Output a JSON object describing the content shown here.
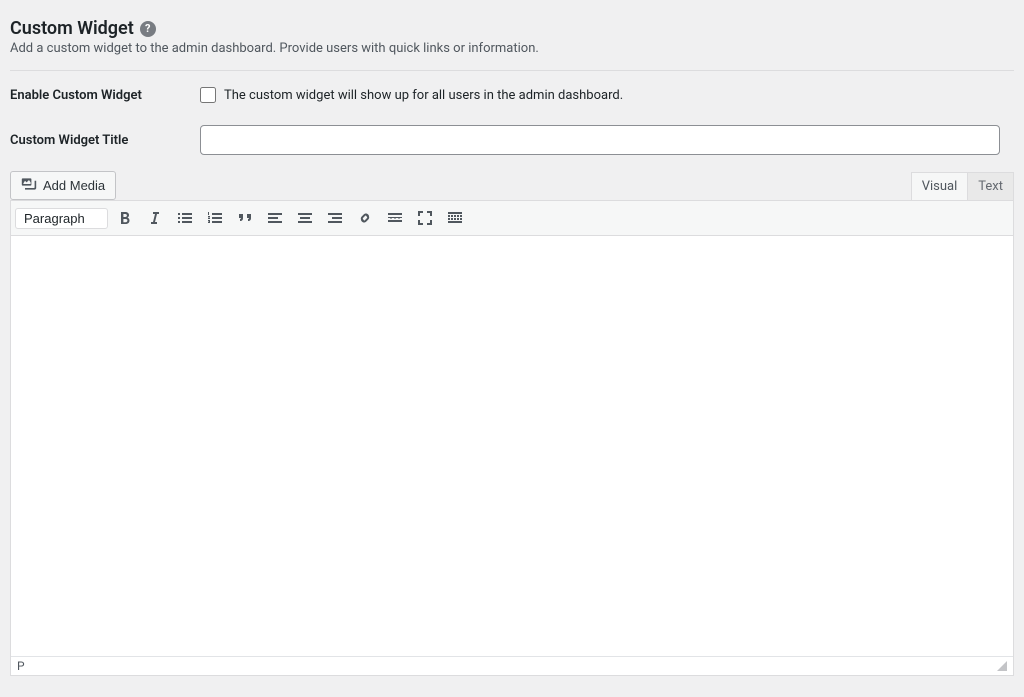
{
  "section": {
    "title": "Custom Widget",
    "description": "Add a custom widget to the admin dashboard. Provide users with quick links or information."
  },
  "fields": {
    "enable": {
      "label": "Enable Custom Widget",
      "desc": "The custom widget will show up for all users in the admin dashboard."
    },
    "title": {
      "label": "Custom Widget Title",
      "value": ""
    }
  },
  "editor": {
    "add_media": "Add Media",
    "tabs": {
      "visual": "Visual",
      "text": "Text"
    },
    "format_select": "Paragraph",
    "status_path": "P"
  }
}
